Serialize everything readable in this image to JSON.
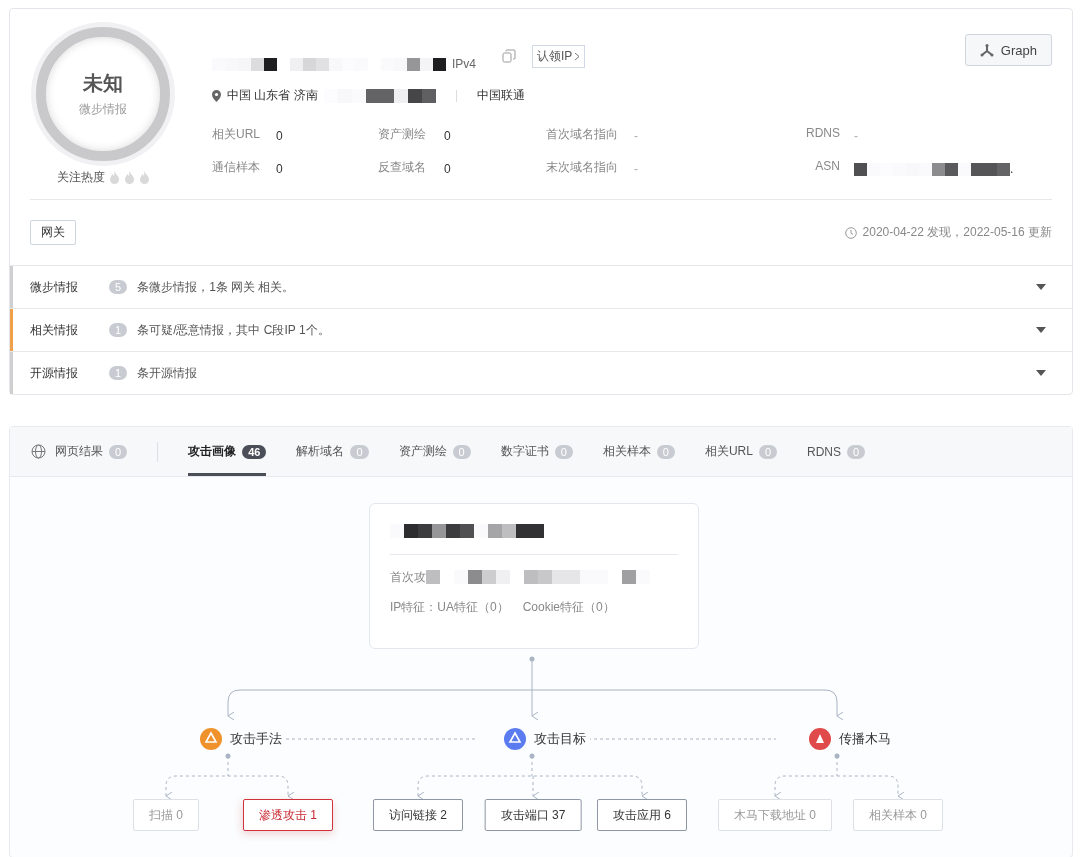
{
  "header": {
    "status": "未知",
    "source": "微步情报",
    "heat_label": "关注热度",
    "stars": 0,
    "ip_type": "IPv4",
    "claim_button": "认领IP",
    "graph_button": "Graph",
    "location": "中国 山东省 济南",
    "isp": "中国联通",
    "stats": [
      {
        "label": "相关URL",
        "value": "0",
        "redacted": false
      },
      {
        "label": "资产测绘",
        "value": "0",
        "redacted": false
      },
      {
        "label": "首次域名指向",
        "value": "-",
        "redacted": false
      },
      {
        "label": "RDNS",
        "value": "-",
        "redacted": false
      },
      {
        "label": "通信样本",
        "value": "0",
        "redacted": false
      },
      {
        "label": "反查域名",
        "value": "0",
        "redacted": false
      },
      {
        "label": "末次域名指向",
        "value": "-",
        "redacted": false
      },
      {
        "label": "ASN",
        "value": ".",
        "redacted": true
      }
    ],
    "tags": [
      "网关"
    ],
    "timestamp": "2020-04-22 发现，2022-05-16 更新"
  },
  "intel": [
    {
      "title": "微步情报",
      "count": "5",
      "text": "条微步情报，1条 网关 相关。",
      "color": "#cfcfcf",
      "expanded": false
    },
    {
      "title": "相关情报",
      "count": "1",
      "text": "条可疑/恶意情报，其中 C段IP 1个。",
      "color": "#f0a04b",
      "expanded": false
    },
    {
      "title": "开源情报",
      "count": "1",
      "text": "条开源情报",
      "color": "#cfcfcf",
      "expanded": false
    }
  ],
  "tabs": [
    {
      "label": "网页结果",
      "count": "0",
      "selected": false
    },
    {
      "label": "攻击画像",
      "count": "46",
      "selected": true
    },
    {
      "label": "解析域名",
      "count": "0",
      "selected": false
    },
    {
      "label": "资产测绘",
      "count": "0",
      "selected": false
    },
    {
      "label": "数字证书",
      "count": "0",
      "selected": false
    },
    {
      "label": "相关样本",
      "count": "0",
      "selected": false
    },
    {
      "label": "相关URL",
      "count": "0",
      "selected": false
    },
    {
      "label": "RDNS",
      "count": "0",
      "selected": false
    }
  ],
  "profile": {
    "first_attack_label": "首次攻",
    "features": [
      "IP特征：",
      "UA特征（0）",
      "Cookie特征（0）"
    ]
  },
  "categories": [
    {
      "label": "攻击手法",
      "color": "#f0922b",
      "leaves": [
        {
          "label": "扫描 0",
          "disabled": true,
          "selected": false
        },
        {
          "label": "渗透攻击 1",
          "disabled": false,
          "selected": true
        }
      ]
    },
    {
      "label": "攻击目标",
      "color": "#5b7cf0",
      "leaves": [
        {
          "label": "访问链接 2",
          "disabled": false,
          "selected": false
        },
        {
          "label": "攻击端口 37",
          "disabled": false,
          "selected": false
        },
        {
          "label": "攻击应用 6",
          "disabled": false,
          "selected": false
        }
      ]
    },
    {
      "label": "传播木马",
      "color": "#e04a4a",
      "leaves": [
        {
          "label": "木马下载地址 0",
          "disabled": true,
          "selected": false
        },
        {
          "label": "相关样本 0",
          "disabled": true,
          "selected": false
        }
      ]
    }
  ]
}
